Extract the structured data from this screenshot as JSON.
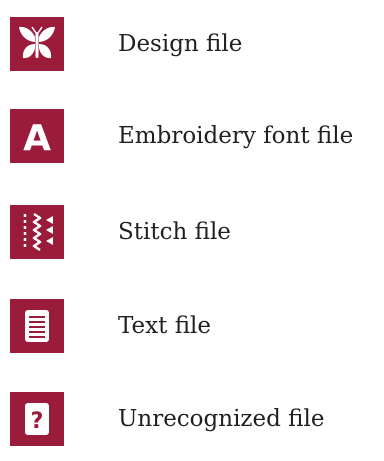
{
  "colors": {
    "tile": "#9b1b3b",
    "glyph": "#ffffff",
    "text": "#231f20"
  },
  "file_types": [
    {
      "icon": "butterfly-icon",
      "label": "Design file"
    },
    {
      "icon": "letter-a-icon",
      "label": "Embroidery font file"
    },
    {
      "icon": "stitch-icon",
      "label": "Stitch file"
    },
    {
      "icon": "text-document-icon",
      "label": "Text file"
    },
    {
      "icon": "question-mark-icon",
      "label": "Unrecognized file"
    }
  ],
  "icon_glyphs": {
    "letter_a": "A",
    "question_mark": "?"
  }
}
